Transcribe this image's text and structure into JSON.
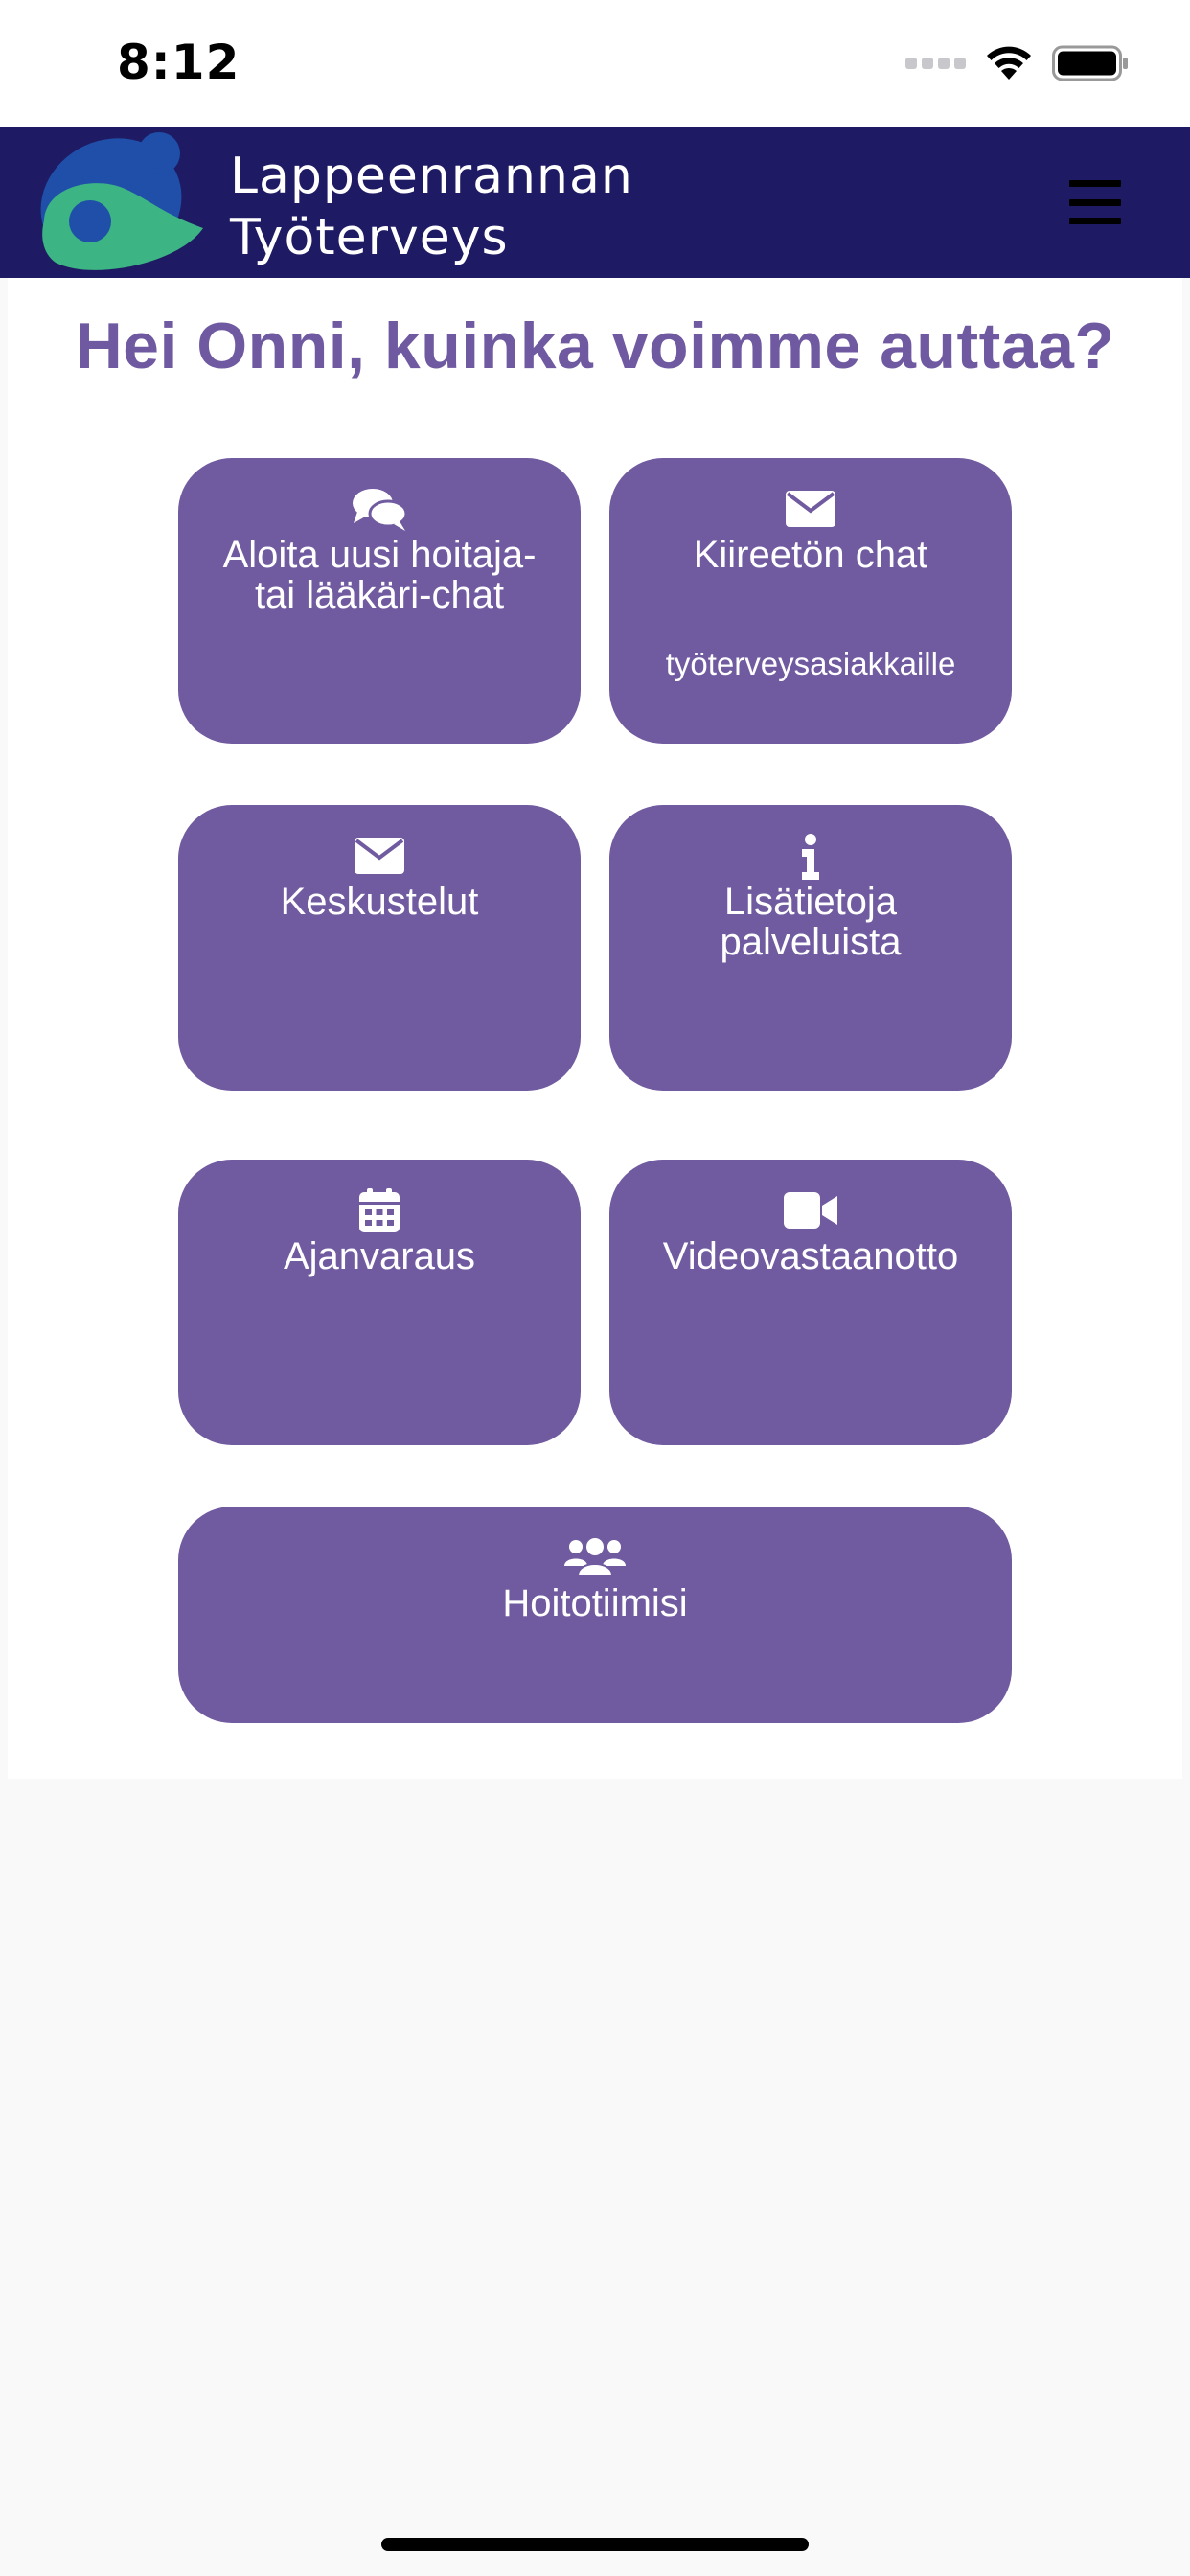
{
  "status_bar": {
    "time": "8:12"
  },
  "header": {
    "brand_line1": "Lappeenrannan",
    "brand_line2": "Työterveys"
  },
  "greeting": "Hei Onni, kuinka voimme auttaa?",
  "tiles": {
    "new_chat": {
      "line1": "Aloita uusi hoitaja-",
      "line2": "tai lääkäri-chat",
      "icon": "comments-icon"
    },
    "non_urgent_chat": {
      "label": "Kiireetön chat",
      "sub": "työterveysasiakkaille",
      "icon": "envelope-icon"
    },
    "conversations": {
      "label": "Keskustelut",
      "icon": "envelope-icon"
    },
    "service_info": {
      "line1": "Lisätietoja",
      "line2": "palveluista",
      "icon": "info-icon"
    },
    "appointment": {
      "label": "Ajanvaraus",
      "icon": "calendar-icon"
    },
    "video": {
      "label": "Videovastaanotto",
      "icon": "video-camera-icon"
    },
    "care_team": {
      "label": "Hoitotiimisi",
      "icon": "users-icon"
    }
  },
  "colors": {
    "header_bg": "#1e1a63",
    "tile_bg": "#705aa0",
    "greeting": "#6f5aa1",
    "logo_blue": "#1f4fa8",
    "logo_green": "#3cb483"
  }
}
